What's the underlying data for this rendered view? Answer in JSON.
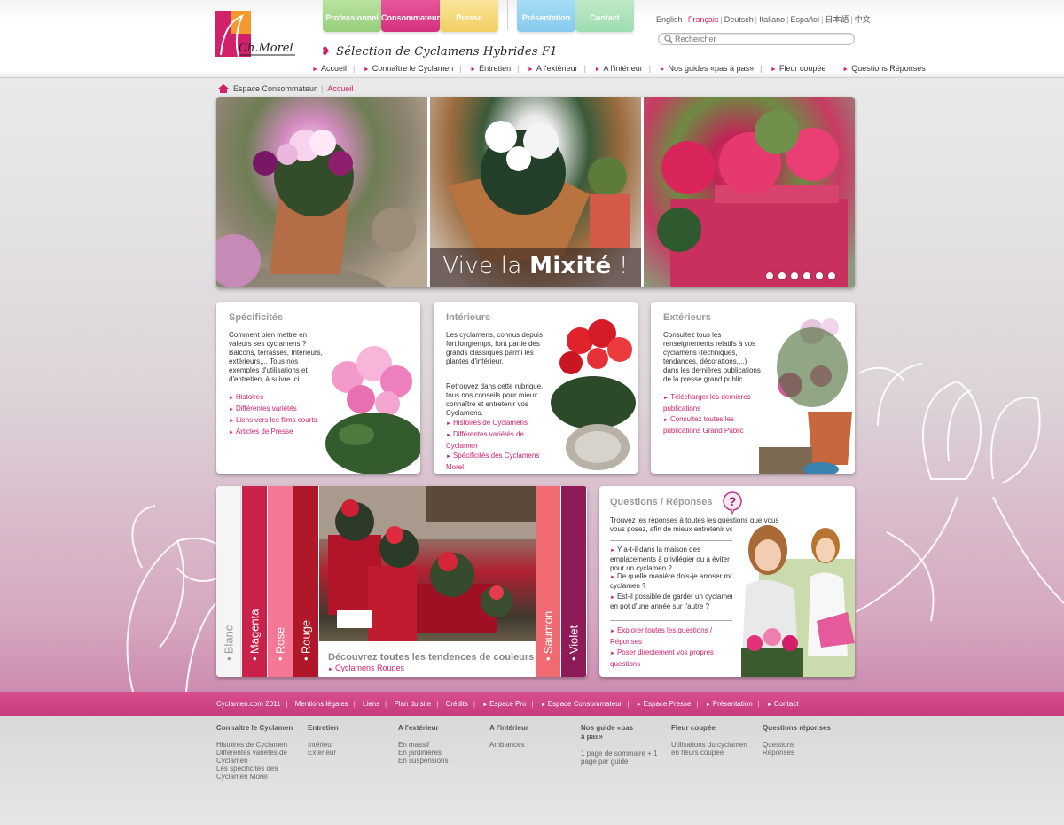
{
  "header": {
    "logo_text": "Ch. Morel",
    "tagline": "Sélection de Cyclamens Hybrides F1",
    "top_tabs": [
      "Professionnel",
      "Consommateur",
      "Presse",
      "Présentation",
      "Contact"
    ],
    "languages": [
      "English",
      "Français",
      "Deutsch",
      "Italiano",
      "Español",
      "日本語",
      "中文"
    ],
    "active_language": "Français",
    "search_placeholder": "Rechercher",
    "main_nav": [
      "Accueil",
      "Connaître le Cyclamen",
      "Entretien",
      "A l'extérieur",
      "A l'intérieur",
      "Nos guides «pas à pas»",
      "Fleur coupée",
      "Questions Réponses"
    ]
  },
  "breadcrumb": {
    "section": "Espace Consommateur",
    "current": "Accueil"
  },
  "hero": {
    "caption_light": "Vive la ",
    "caption_bold": "Mixité",
    "caption_end": " !",
    "slide_count": 6
  },
  "cards": [
    {
      "title": "Spécificités",
      "text": "Comment bien mettre en valeurs ses cyclamens ? Balcons, terrasses, Intérieurs, extérieurs,... Tous nos exemples d'utilisations et d'entretien, à suivre ici.",
      "links": [
        "Histoires",
        "Différentes variétés",
        "Liens vers les films courts",
        "Articles de Presse"
      ]
    },
    {
      "title": "Intérieurs",
      "text": "Les cyclamens, connus depuis fort longtemps, font partie des grands classiques parmi les plantes d'intérieur.",
      "text2": "Retrouvez dans cette rubrique, tous nos conseils pour mieux connaître et entretenir vos Cyclamens.",
      "links": [
        "Histoires de Cyclamens",
        "Différentes variétés de Cyclamen",
        "Spécificités des Cyclamens Morel"
      ]
    },
    {
      "title": "Extérieurs",
      "text": "Consultez tous les renseignements relatifs à vos cyclamens (techniques, tendances, décorations,...) dans les dernières publications de la presse grand public.",
      "links": [
        "Télécharger les dernières publications",
        "Consultez toutes les publications Grand Public"
      ]
    }
  ],
  "colors_panel": {
    "stripes": [
      "Blanc",
      "Magenta",
      "Rose",
      "Rouge",
      "Saumon",
      "Violet"
    ],
    "caption": "Découvrez toutes les tendences de couleurs",
    "link": "Cyclamens Rouges"
  },
  "qa": {
    "title": "Questions / Réponses",
    "intro": "Trouvez les réponses à toutes les questions que vous vous posez, afin de mieux entretenir vos Cyclamens.",
    "questions": [
      "Y a-t-il dans la maison des emplacements à privilégier ou à éviter pour un cyclamen ?",
      "De quelle manière dois-je arroser mon cyclamen ?",
      "Est-il possible de garder un cyclamen en pot d'une année sur l'autre ?"
    ],
    "links": [
      "Explorer toutes les questions / Réponses",
      "Poser directement vos propres questions"
    ]
  },
  "footer": {
    "copyright": "Cyclamen.com 2011",
    "links": [
      "Mentions légales",
      "Liens",
      "Plan du site",
      "Crédits"
    ],
    "arrow_links": [
      "Espace Pro",
      "Espace Consommateur",
      "Espace Presse",
      "Présentation",
      "Contact"
    ]
  },
  "sitemap": [
    {
      "heading": "Connaître le Cyclamen",
      "items": [
        "Histoires de Cyclamen",
        "Différentes variétés de Cyclamen",
        "Les spécificités des Cyclamen Morel"
      ]
    },
    {
      "heading": "Entretien",
      "items": [
        "Intérieur",
        "Extérieur"
      ]
    },
    {
      "heading": "A l'extérieur",
      "items": [
        "En massif",
        "En jardinières",
        "En suspensions"
      ]
    },
    {
      "heading": "A l'intérieur",
      "items": [
        "Ambiances"
      ]
    },
    {
      "heading": "Nos guide «pas à pas»",
      "items": [
        "1 page de sommaire + 1 page par guide"
      ]
    },
    {
      "heading": "Fleur coupée",
      "items": [
        "Utilisations du cyclamen en fleurs coupée"
      ]
    },
    {
      "heading": "Questions réponses",
      "items": [
        "Questions Réponses"
      ]
    }
  ],
  "colors": {
    "accent": "#d2206b",
    "footer_bar": "#c63b7a"
  }
}
